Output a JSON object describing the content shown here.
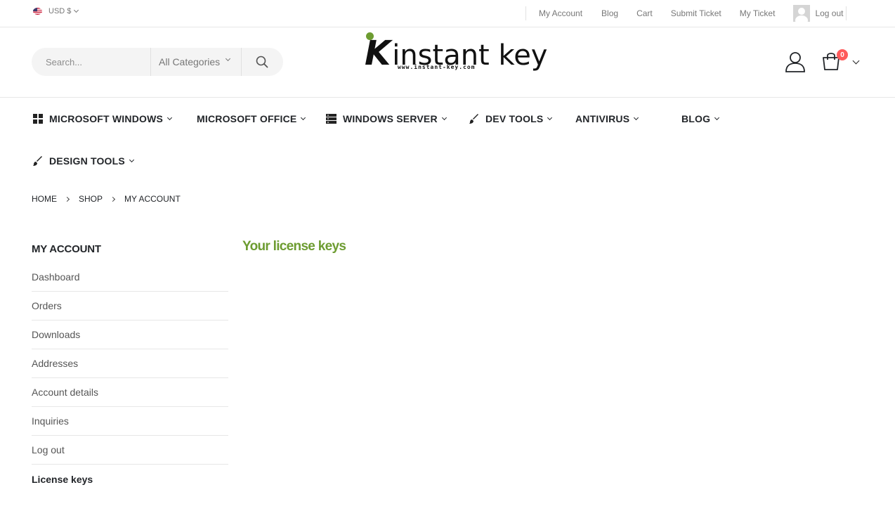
{
  "topbar": {
    "currency": "USD $",
    "links": {
      "my_account": "My Account",
      "blog": "Blog",
      "cart": "Cart",
      "submit_ticket": "Submit Ticket",
      "my_ticket": "My Ticket",
      "log_out": "Log out"
    }
  },
  "header": {
    "search": {
      "placeholder": "Search...",
      "category": "All Categories"
    },
    "logo": {
      "brand_k": "K",
      "brand_rest": "instant key",
      "url": "www.instant-key.com",
      "dot_color": "#6d9c31"
    },
    "cart": {
      "count": "0",
      "badge_color": "#ff5b5b"
    }
  },
  "nav": {
    "items": [
      {
        "label": "MICROSOFT WINDOWS",
        "icon": "windows-icon"
      },
      {
        "label": "MICROSOFT OFFICE",
        "icon": ""
      },
      {
        "label": "WINDOWS SERVER",
        "icon": "server-icon"
      },
      {
        "label": "DEV TOOLS",
        "icon": "brush-icon"
      },
      {
        "label": "ANTIVIRUS",
        "icon": ""
      },
      {
        "label": "BLOG",
        "icon": ""
      },
      {
        "label": "DESIGN TOOLS",
        "icon": "brush-icon"
      }
    ]
  },
  "breadcrumb": {
    "home": "HOME",
    "shop": "SHOP",
    "current": "MY ACCOUNT"
  },
  "sidebar": {
    "title": "MY ACCOUNT",
    "items": [
      {
        "label": "Dashboard"
      },
      {
        "label": "Orders"
      },
      {
        "label": "Downloads"
      },
      {
        "label": "Addresses"
      },
      {
        "label": "Account details"
      },
      {
        "label": "Inquiries"
      },
      {
        "label": "Log out"
      },
      {
        "label": "License keys",
        "active": true
      }
    ]
  },
  "main": {
    "title": "Your license keys",
    "accent_color": "#6d9c31"
  }
}
